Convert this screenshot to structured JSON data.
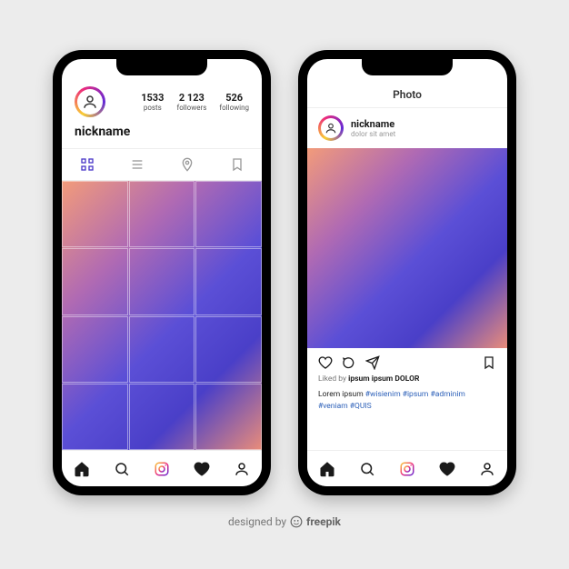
{
  "profile": {
    "nickname": "nickname",
    "stats": [
      {
        "count": "1533",
        "label": "posts"
      },
      {
        "count": "2 123",
        "label": "followers"
      },
      {
        "count": "526",
        "label": "following"
      }
    ]
  },
  "post": {
    "topbar_title": "Photo",
    "username": "nickname",
    "subtitle": "dolor sit amet",
    "likes_prefix": "Liked by",
    "likes_name": "ipsum ipsum DOLOR",
    "caption_plain": "Lorem ipsum",
    "caption_tags": "#wisienim #ipsum #adminim #veniam #QUIS"
  },
  "footer": {
    "text": "designed by",
    "brand": "freepik"
  }
}
